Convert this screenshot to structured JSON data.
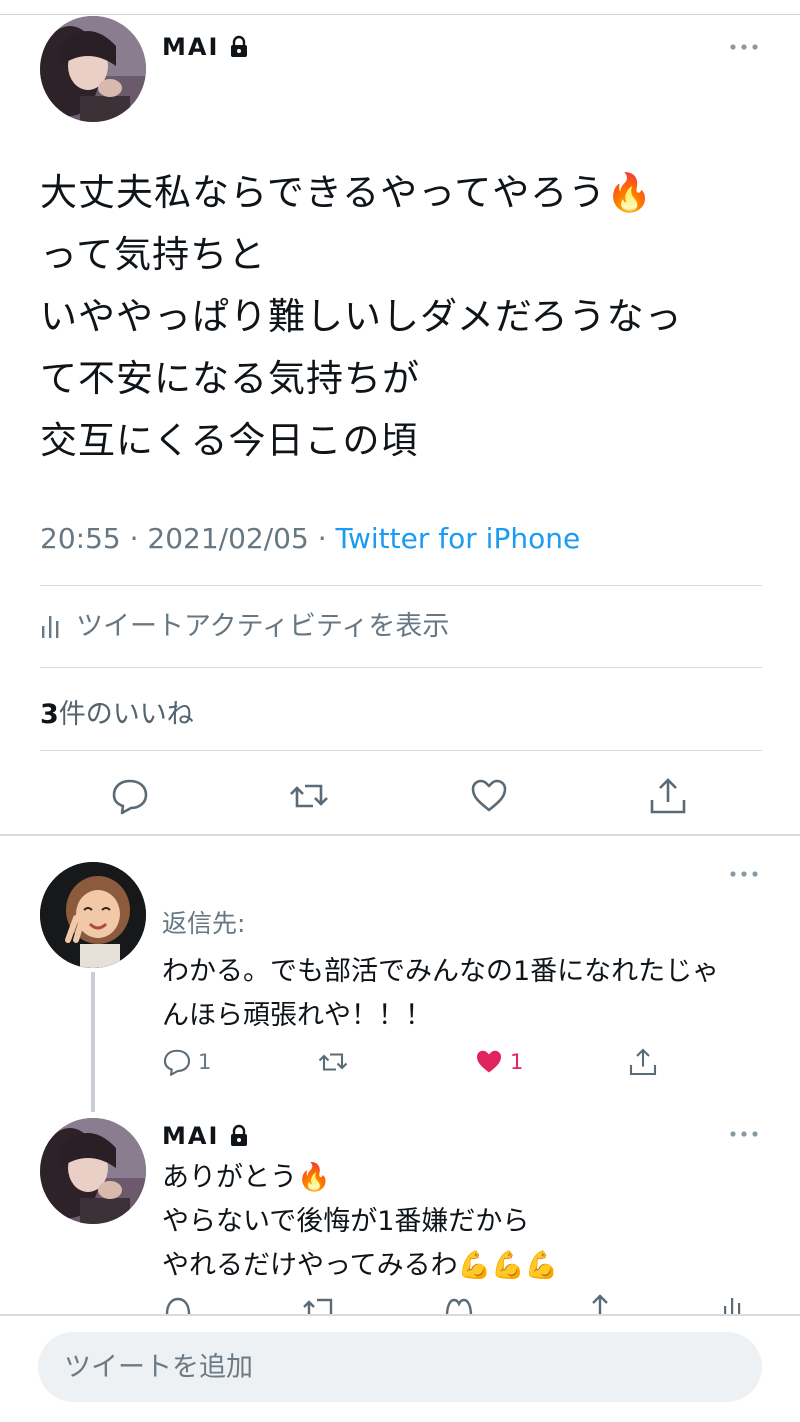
{
  "main_tweet": {
    "author_name": "MAI",
    "text": "大丈夫私ならできるやってやろう🔥\nって気持ちと\nいややっぱり難しいしダメだろうなっ\nて不安になる気持ちが\n交互にくる今日この頃",
    "time": "20:55",
    "date": "2021/02/05",
    "source": "Twitter for iPhone",
    "activity_label": "ツイートアクティビティを表示",
    "likes_count": "3",
    "likes_label": "件のいいね"
  },
  "reply": {
    "reply_to_label": "返信先:",
    "text": "わかる。でも部活でみんなの1番になれたじゃ\nんほら頑張れや！！！",
    "reply_count": "1",
    "like_count": "1"
  },
  "reply2": {
    "author_name": "MAI",
    "text": "ありがとう🔥\nやらないで後悔が1番嫌だから\nやれるだけやってみるわ💪💪💪"
  },
  "composer": {
    "placeholder": "ツイートを追加"
  },
  "colors": {
    "accent": "#1d9bf0",
    "like": "#e0245e",
    "muted": "#687883"
  }
}
